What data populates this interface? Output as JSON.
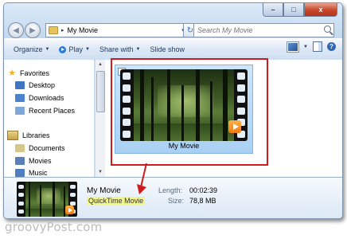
{
  "window": {
    "controls": {
      "minimize": "–",
      "maximize": "□",
      "close": "x"
    }
  },
  "nav_buttons": {
    "back": "◀",
    "forward": "▶"
  },
  "address": {
    "path": [
      "My Movie"
    ],
    "separator": "▸",
    "dropdown": "▾"
  },
  "refresh_icon": "↻",
  "search": {
    "placeholder": "Search My Movie"
  },
  "toolbar": {
    "organize": "Organize",
    "play": "Play",
    "share_with": "Share with",
    "slide_show": "Slide show",
    "dropdown_arrow": "▼",
    "help": "?"
  },
  "sidebar": {
    "groups": [
      {
        "label": "Favorites",
        "icon": "star-icon",
        "items": [
          {
            "label": "Desktop",
            "icon": "desktop-icon",
            "color": "#3f76c4"
          },
          {
            "label": "Downloads",
            "icon": "downloads-icon",
            "color": "#4c83cf"
          },
          {
            "label": "Recent Places",
            "icon": "recent-places-icon",
            "color": "#7fa6d8"
          }
        ]
      },
      {
        "label": "Libraries",
        "icon": "libraries-icon",
        "items": [
          {
            "label": "Documents",
            "icon": "documents-icon",
            "color": "#d8c58a"
          },
          {
            "label": "Movies",
            "icon": "movies-icon",
            "color": "#5b7fb8"
          },
          {
            "label": "Music",
            "icon": "music-icon",
            "color": "#4f7ec0"
          }
        ]
      }
    ],
    "scroll_up": "▲",
    "scroll_down": "▼"
  },
  "file_tile": {
    "name": "My Movie",
    "checked": true,
    "check_glyph": "✓"
  },
  "details": {
    "name": "My Movie",
    "type": "QuickTime Movie",
    "length_label": "Length:",
    "length_value": "00:02:39",
    "size_label": "Size:",
    "size_value": "78,8 MB"
  },
  "watermark": "groovyPost.com",
  "colors": {
    "highlight": "#f3f58a",
    "annotation": "#cf1b1b",
    "close_button": "#c8452a"
  }
}
